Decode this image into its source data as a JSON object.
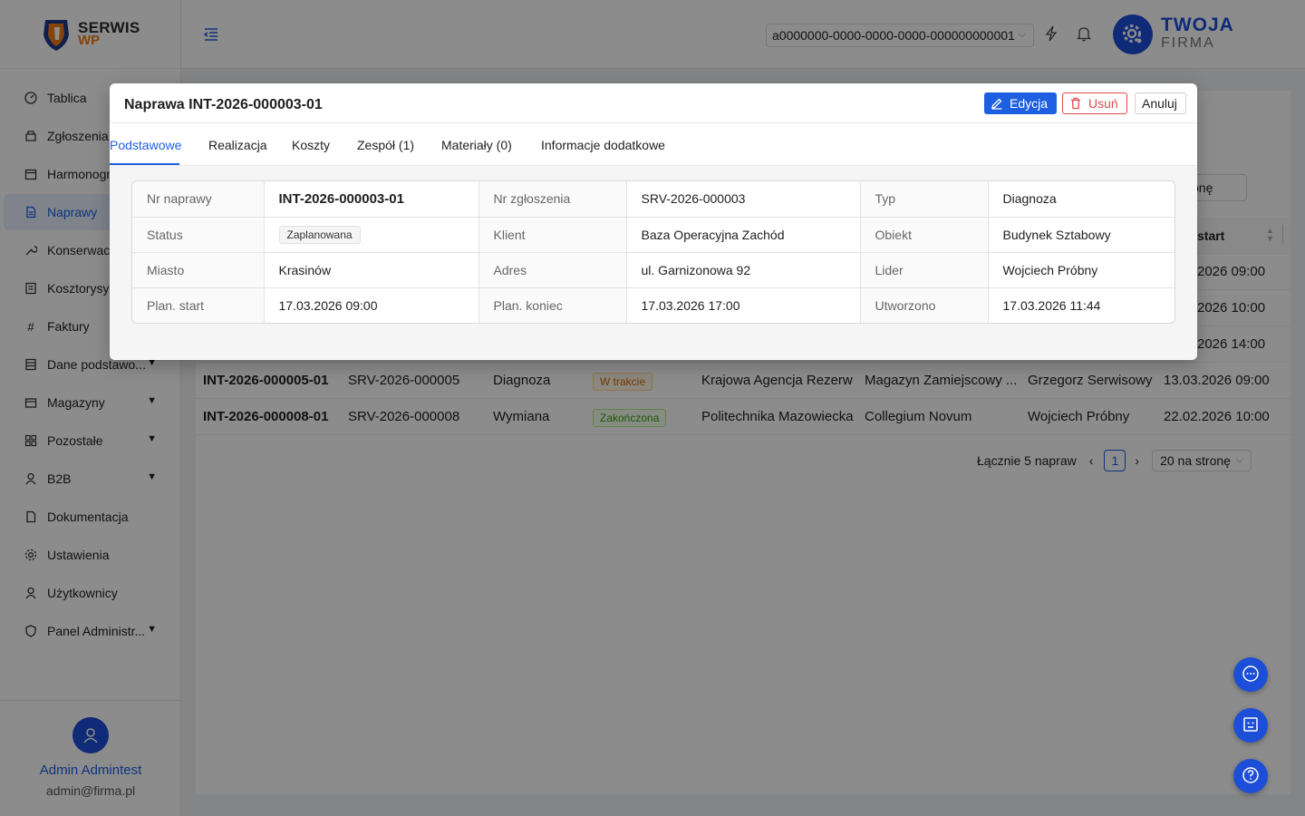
{
  "sidebar": {
    "logo_line1": "SERWIS",
    "logo_line2": "WP",
    "items": [
      {
        "label": "Tablica",
        "icon": "dashboard-icon"
      },
      {
        "label": "Zgłoszenia",
        "icon": "tickets-icon"
      },
      {
        "label": "Harmonogram",
        "icon": "calendar-icon"
      },
      {
        "label": "Naprawy",
        "icon": "document-icon"
      },
      {
        "label": "Konserwacje",
        "icon": "wrench-icon"
      },
      {
        "label": "Kosztorysy",
        "icon": "estimate-icon"
      },
      {
        "label": "Faktury",
        "icon": "hash-icon"
      },
      {
        "label": "Dane podstawo...",
        "icon": "data-icon"
      },
      {
        "label": "Magazyny",
        "icon": "warehouse-icon"
      },
      {
        "label": "Pozostałe",
        "icon": "grid-icon"
      },
      {
        "label": "B2B",
        "icon": "user-icon"
      },
      {
        "label": "Dokumentacja",
        "icon": "docs-icon"
      },
      {
        "label": "Ustawienia",
        "icon": "gear-icon"
      },
      {
        "label": "Użytkownicy",
        "icon": "users-icon"
      },
      {
        "label": "Panel Administr...",
        "icon": "shield-icon"
      }
    ],
    "user_name": "Admin Admintest",
    "user_email": "admin@firma.pl"
  },
  "header": {
    "tenant_id": "a0000000-0000-0000-0000-000000000001",
    "brand_line1": "TWOJA",
    "brand_line2": "FIRMA"
  },
  "table": {
    "per_page_partial": "onę",
    "start_header": "start",
    "partial_dates": [
      "2026 09:00",
      "2026 10:00",
      "2026 14:00"
    ],
    "rows": [
      {
        "nr": "INT-2026-000005-01",
        "zgl": "SRV-2026-000005",
        "typ": "Diagnoza",
        "status": "W trakcie",
        "klient": "Krajowa Agencja Rezerw",
        "obiekt": "Magazyn Zamiejscowy ...",
        "lider": "Grzegorz Serwisowy",
        "start": "13.03.2026 09:00"
      },
      {
        "nr": "INT-2026-000008-01",
        "zgl": "SRV-2026-000008",
        "typ": "Wymiana",
        "status": "Zakończona",
        "klient": "Politechnika Mazowiecka",
        "obiekt": "Collegium Novum",
        "lider": "Wojciech Próbny",
        "start": "22.02.2026 10:00"
      }
    ],
    "total": "Łącznie 5 napraw",
    "page": "1",
    "per_page": "20 na stronę"
  },
  "modal": {
    "title": "Naprawa INT-2026-000003-01",
    "edit_label": "Edycja",
    "delete_label": "Usuń",
    "cancel_label": "Anuluj",
    "tabs": [
      "Podstawowe",
      "Realizacja",
      "Koszty",
      "Zespół (1)",
      "Materiały (0)",
      "Informacje dodatkowe"
    ],
    "fields": {
      "nr_naprawy_label": "Nr naprawy",
      "nr_naprawy": "INT-2026-000003-01",
      "nr_zgloszenia_label": "Nr zgłoszenia",
      "nr_zgloszenia": "SRV-2026-000003",
      "typ_label": "Typ",
      "typ": "Diagnoza",
      "status_label": "Status",
      "status": "Zaplanowana",
      "klient_label": "Klient",
      "klient": "Baza Operacyjna Zachód",
      "obiekt_label": "Obiekt",
      "obiekt": "Budynek Sztabowy",
      "miasto_label": "Miasto",
      "miasto": "Krasinów",
      "adres_label": "Adres",
      "adres": "ul. Garnizonowa 92",
      "lider_label": "Lider",
      "lider": "Wojciech Próbny",
      "plan_start_label": "Plan. start",
      "plan_start": "17.03.2026 09:00",
      "plan_koniec_label": "Plan. koniec",
      "plan_koniec": "17.03.2026 17:00",
      "utworzono_label": "Utworzono",
      "utworzono": "17.03.2026 11:44"
    }
  },
  "colors": {
    "primary": "#1d5fe0",
    "brand_blue": "#1d4ed8",
    "danger": "#e5484d",
    "logo_orange": "#f07c10"
  }
}
